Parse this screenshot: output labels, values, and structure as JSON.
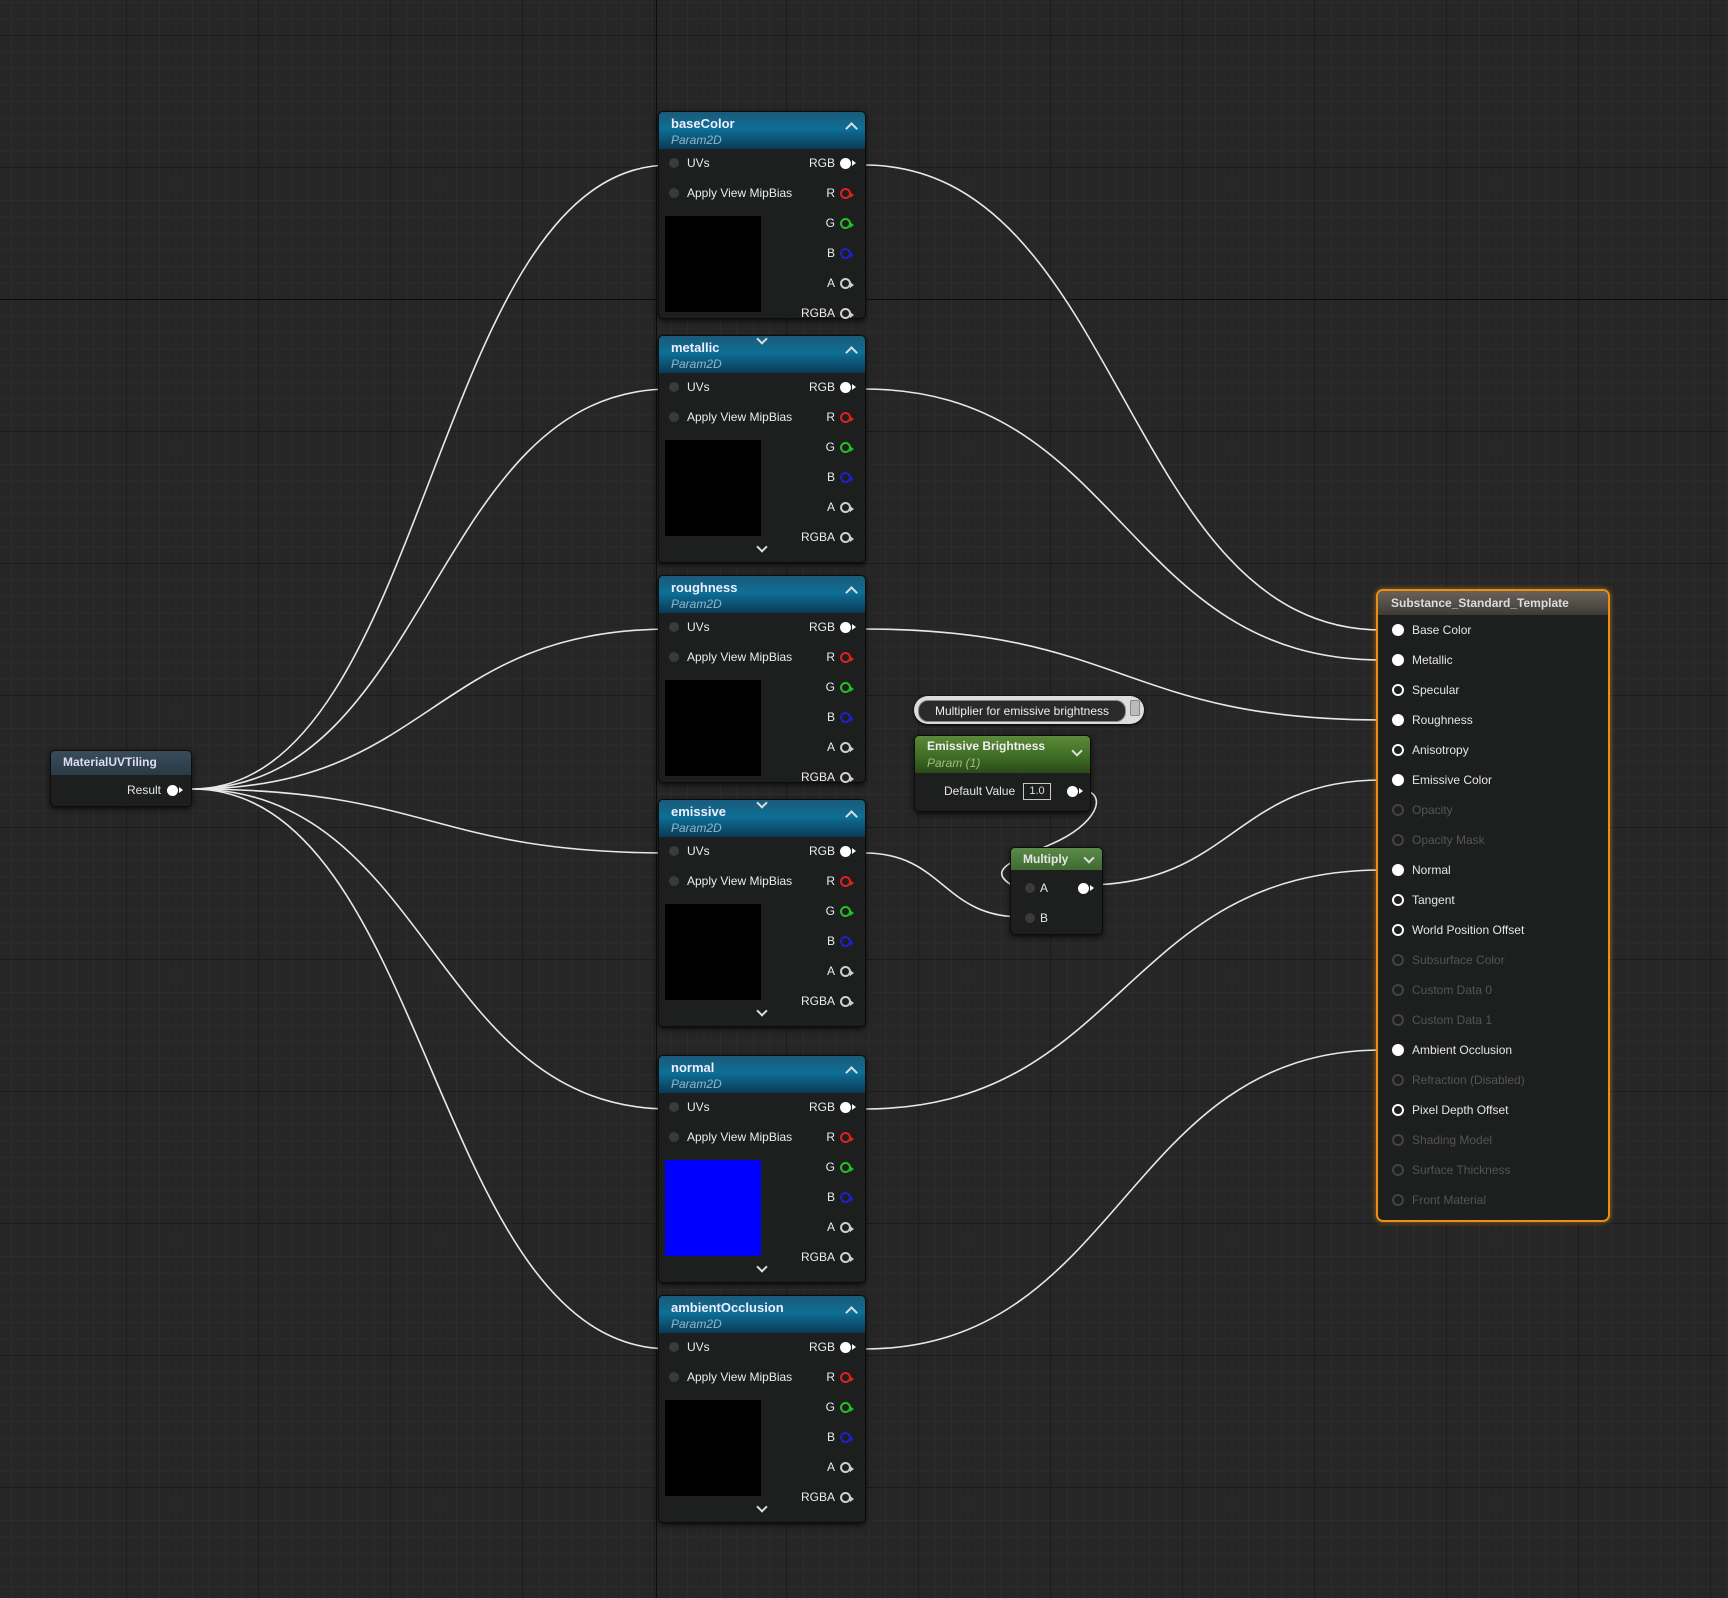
{
  "texture_nodes": [
    {
      "title": "baseColor",
      "subtitle": "Param2D",
      "uvs": "UVs",
      "mip": "Apply View MipBias",
      "outputs": [
        "RGB",
        "R",
        "G",
        "B",
        "A",
        "RGBA"
      ],
      "preview": "#000000",
      "collapse_toggle": false,
      "expand_toggle": false
    },
    {
      "title": "metallic",
      "subtitle": "Param2D",
      "uvs": "UVs",
      "mip": "Apply View MipBias",
      "outputs": [
        "RGB",
        "R",
        "G",
        "B",
        "A",
        "RGBA"
      ],
      "preview": "#000000",
      "collapse_toggle": true,
      "expand_toggle": true
    },
    {
      "title": "roughness",
      "subtitle": "Param2D",
      "uvs": "UVs",
      "mip": "Apply View MipBias",
      "outputs": [
        "RGB",
        "R",
        "G",
        "B",
        "A",
        "RGBA"
      ],
      "preview": "#000000",
      "collapse_toggle": false,
      "expand_toggle": false
    },
    {
      "title": "emissive",
      "subtitle": "Param2D",
      "uvs": "UVs",
      "mip": "Apply View MipBias",
      "outputs": [
        "RGB",
        "R",
        "G",
        "B",
        "A",
        "RGBA"
      ],
      "preview": "#000000",
      "collapse_toggle": true,
      "expand_toggle": true
    },
    {
      "title": "normal",
      "subtitle": "Param2D",
      "uvs": "UVs",
      "mip": "Apply View MipBias",
      "outputs": [
        "RGB",
        "R",
        "G",
        "B",
        "A",
        "RGBA"
      ],
      "preview": "#0000ff",
      "collapse_toggle": false,
      "expand_toggle": true
    },
    {
      "title": "ambientOcclusion",
      "subtitle": "Param2D",
      "uvs": "UVs",
      "mip": "Apply View MipBias",
      "outputs": [
        "RGB",
        "R",
        "G",
        "B",
        "A",
        "RGBA"
      ],
      "preview": "#000000",
      "collapse_toggle": false,
      "expand_toggle": true
    }
  ],
  "uv_tiling": {
    "title": "MaterialUVTiling",
    "output": "Result"
  },
  "emissive_param": {
    "tooltip": "Multiplier for emissive brightness",
    "title": "Emissive Brightness",
    "subtitle": "Param (1)",
    "default_label": "Default Value",
    "default_value": "1.0"
  },
  "multiply": {
    "title": "Multiply",
    "a": "A",
    "b": "B"
  },
  "material": {
    "title": "Substance_Standard_Template",
    "inputs": [
      {
        "label": "Base Color",
        "state": "connected"
      },
      {
        "label": "Metallic",
        "state": "connected"
      },
      {
        "label": "Specular",
        "state": "open"
      },
      {
        "label": "Roughness",
        "state": "connected"
      },
      {
        "label": "Anisotropy",
        "state": "open"
      },
      {
        "label": "Emissive Color",
        "state": "connected"
      },
      {
        "label": "Opacity",
        "state": "disabled"
      },
      {
        "label": "Opacity Mask",
        "state": "disabled"
      },
      {
        "label": "Normal",
        "state": "connected"
      },
      {
        "label": "Tangent",
        "state": "open"
      },
      {
        "label": "World Position Offset",
        "state": "open"
      },
      {
        "label": "Subsurface Color",
        "state": "disabled"
      },
      {
        "label": "Custom Data 0",
        "state": "disabled"
      },
      {
        "label": "Custom Data 1",
        "state": "disabled"
      },
      {
        "label": "Ambient Occlusion",
        "state": "connected"
      },
      {
        "label": "Refraction (Disabled)",
        "state": "disabled"
      },
      {
        "label": "Pixel Depth Offset",
        "state": "open"
      },
      {
        "label": "Shading Model",
        "state": "disabled"
      },
      {
        "label": "Surface Thickness",
        "state": "disabled"
      },
      {
        "label": "Front Material",
        "state": "disabled"
      }
    ]
  },
  "colors": {
    "accent_selected": "#e98f12",
    "param_header": "#0d6f96",
    "scalar_header": "#3d6a22",
    "wire": "#e8e8e8"
  }
}
